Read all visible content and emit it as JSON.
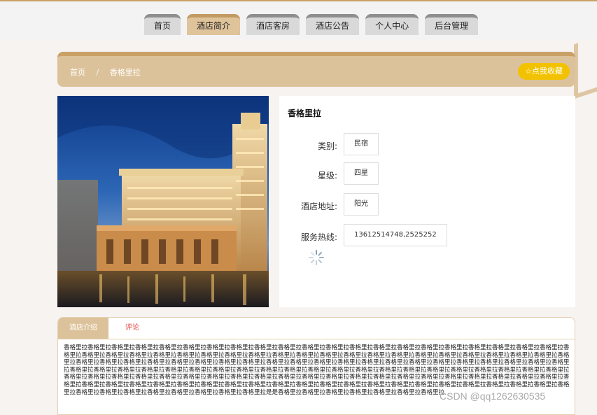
{
  "nav": {
    "items": [
      {
        "label": "首页",
        "active": false
      },
      {
        "label": "酒店简介",
        "active": true
      },
      {
        "label": "酒店客房",
        "active": false
      },
      {
        "label": "酒店公告",
        "active": false
      },
      {
        "label": "个人中心",
        "active": false
      },
      {
        "label": "后台管理",
        "active": false
      }
    ]
  },
  "breadcrumb": {
    "home": "首页",
    "separator": "/",
    "current": "香格里拉"
  },
  "favorite_button": "☆点我收藏",
  "hotel": {
    "name": "香格里拉",
    "fields": [
      {
        "label": "类别:",
        "value": "民宿"
      },
      {
        "label": "星级:",
        "value": "四星"
      },
      {
        "label": "酒店地址:",
        "value": "阳光"
      },
      {
        "label": "服务热线:",
        "value": "13612514748,2525252"
      }
    ]
  },
  "tabs": {
    "intro": "酒店介绍",
    "comment": "评论"
  },
  "description": "香格里拉香格里拉香格里拉香格里拉香格里拉香格里拉香格里拉香格里拉香格里拉香格里拉香格里拉香格里拉香格里拉香格里拉香格里拉香格里拉香格里拉香格里拉香格里拉香格里拉香格里拉香格里拉香格里拉香格里拉香格里拉香格里拉香格里拉香格里拉香格里拉香格里拉香格里拉香格里拉香格里拉香格里拉香格里拉香格里拉香格里拉香格里拉香格里拉香格里拉香格里拉香格里拉香格里拉香格里拉香格里拉香格里拉香格里拉香格里拉香格里拉香格里拉香格里拉香格里拉香格里拉香格里拉香格里拉香格里拉香格里拉香格里拉香格里拉香格里拉香格里拉香格里拉香格里拉香格里拉香格里拉香格里拉香格里拉香格里拉香格里拉香格里拉香格里拉香格里拉香格里拉香格里拉香格里拉香格里拉香格里拉香格里拉香格里拉香格里拉香格里拉香格里拉香格里拉香格里拉香格里拉香格里拉香格里拉香格里拉香格里拉香格里拉香格里拉香格里拉香格里拉香格里拉香格里拉香格里拉香格里拉香格里拉香格里拉香格里拉香格里拉香格里拉香格里拉香格里拉香格里拉香格里拉香格里拉香格里拉香格里拉香格里拉香格里拉香格里拉香格里拉香格里拉香格里拉香格里拉香格里拉香格里拉香格里拉香格里拉香格里拉香格里拉香格里拉香格里拉香格里拉香格里拉香格里拉香格里拉香格里拉香格里拉香格里拉香格里拉香格里拉香格里拉香格里拉香格里拉是是香格里拉香格里拉香格里拉香格里拉香格里拉香格里拉香格里拉",
  "watermark": "CSDN @qq1262630535",
  "colors": {
    "accent": "#c9a066",
    "tab_active": "#dcc29a",
    "favorite": "#f2c200",
    "comment_tab": "#e03c3c"
  }
}
